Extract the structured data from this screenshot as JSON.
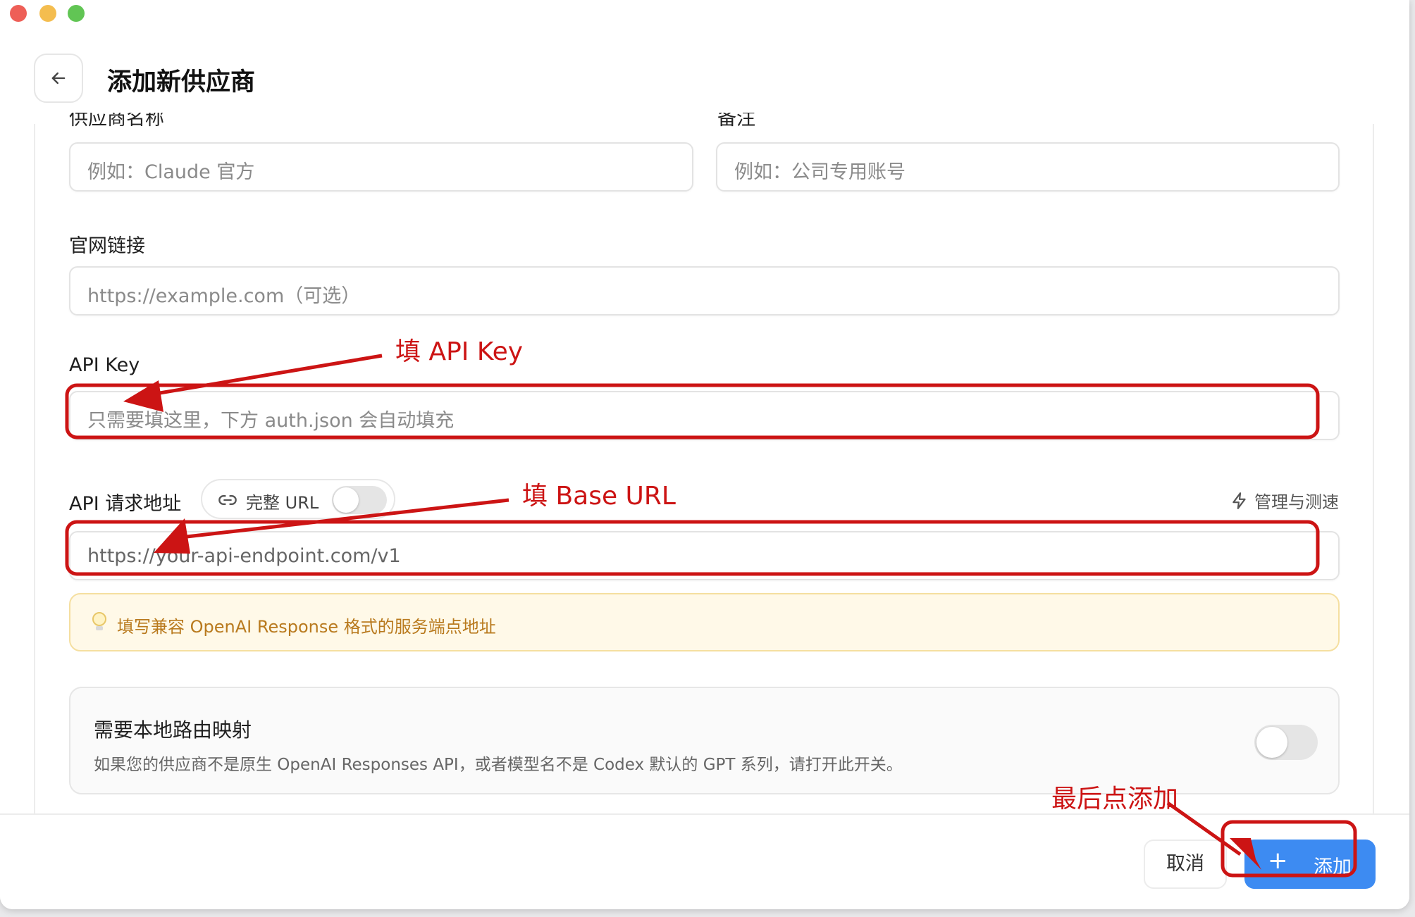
{
  "page": {
    "title": "添加新供应商"
  },
  "form": {
    "name_placeholder": "例如：Claude 官方",
    "note_placeholder": "例如：公司专用账号",
    "website": {
      "label": "官网链接",
      "placeholder": "https://example.com（可选）"
    },
    "api_key": {
      "label": "API Key",
      "placeholder": "只需要填这里，下方 auth.json 会自动填充"
    },
    "api_url": {
      "label": "API 请求地址",
      "full_url_toggle": "完整 URL",
      "manage_link": "管理与测速",
      "placeholder": "https://your-api-endpoint.com/v1",
      "hint": "填写兼容 OpenAI Response 格式的服务端点地址"
    },
    "local_routing": {
      "title": "需要本地路由映射",
      "description": "如果您的供应商不是原生 OpenAI Responses API，或者模型名不是 Codex 默认的 GPT 系列，请打开此开关。"
    }
  },
  "footer": {
    "cancel_label": "取消",
    "add_label": "添加"
  },
  "annotations": {
    "api_key_note": "填 API Key",
    "base_url_note": "填 Base URL",
    "add_note": "最后点添加",
    "color": "#cc1414"
  },
  "icons": [
    "back-arrow-icon",
    "link-icon",
    "lightning-icon",
    "bulb-icon",
    "plus-icon"
  ]
}
